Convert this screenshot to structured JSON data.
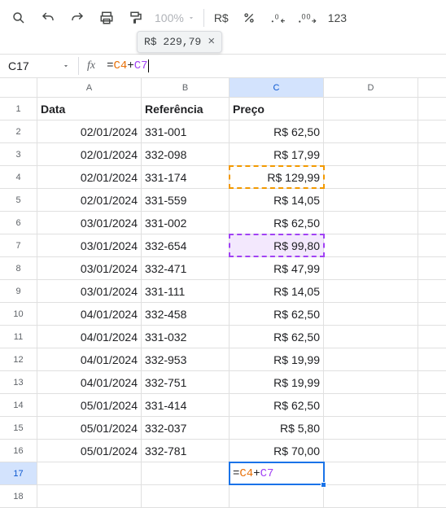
{
  "tooltip": {
    "value": "R$ 229,79"
  },
  "name_box": {
    "value": "C17"
  },
  "formula": {
    "full": "=C4+C7",
    "ref1": "C4",
    "ref2": "C7"
  },
  "toolbar": {
    "zoom": "100%",
    "currency_btn": "R$",
    "numeric_btn": "123"
  },
  "columns": [
    "A",
    "B",
    "C",
    "D"
  ],
  "headers": {
    "a": "Data",
    "b": "Referência",
    "c": "Preço"
  },
  "rows": [
    {
      "n": "1"
    },
    {
      "n": "2",
      "a": "02/01/2024",
      "b": "331-001",
      "c": "R$ 62,50"
    },
    {
      "n": "3",
      "a": "02/01/2024",
      "b": "332-098",
      "c": "R$ 17,99"
    },
    {
      "n": "4",
      "a": "02/01/2024",
      "b": "331-174",
      "c": "R$ 129,99"
    },
    {
      "n": "5",
      "a": "02/01/2024",
      "b": "331-559",
      "c": "R$ 14,05"
    },
    {
      "n": "6",
      "a": "03/01/2024",
      "b": "331-002",
      "c": "R$ 62,50"
    },
    {
      "n": "7",
      "a": "03/01/2024",
      "b": "332-654",
      "c": "R$ 99,80"
    },
    {
      "n": "8",
      "a": "03/01/2024",
      "b": "332-471",
      "c": "R$ 47,99"
    },
    {
      "n": "9",
      "a": "03/01/2024",
      "b": "331-111",
      "c": "R$ 14,05"
    },
    {
      "n": "10",
      "a": "04/01/2024",
      "b": "332-458",
      "c": "R$ 62,50"
    },
    {
      "n": "11",
      "a": "04/01/2024",
      "b": "331-032",
      "c": "R$ 62,50"
    },
    {
      "n": "12",
      "a": "04/01/2024",
      "b": "332-953",
      "c": "R$ 19,99"
    },
    {
      "n": "13",
      "a": "04/01/2024",
      "b": "332-751",
      "c": "R$ 19,99"
    },
    {
      "n": "14",
      "a": "05/01/2024",
      "b": "331-414",
      "c": "R$ 62,50"
    },
    {
      "n": "15",
      "a": "05/01/2024",
      "b": "332-037",
      "c": "R$ 5,80"
    },
    {
      "n": "16",
      "a": "05/01/2024",
      "b": "332-781",
      "c": "R$ 70,00"
    },
    {
      "n": "17"
    },
    {
      "n": "18"
    }
  ]
}
